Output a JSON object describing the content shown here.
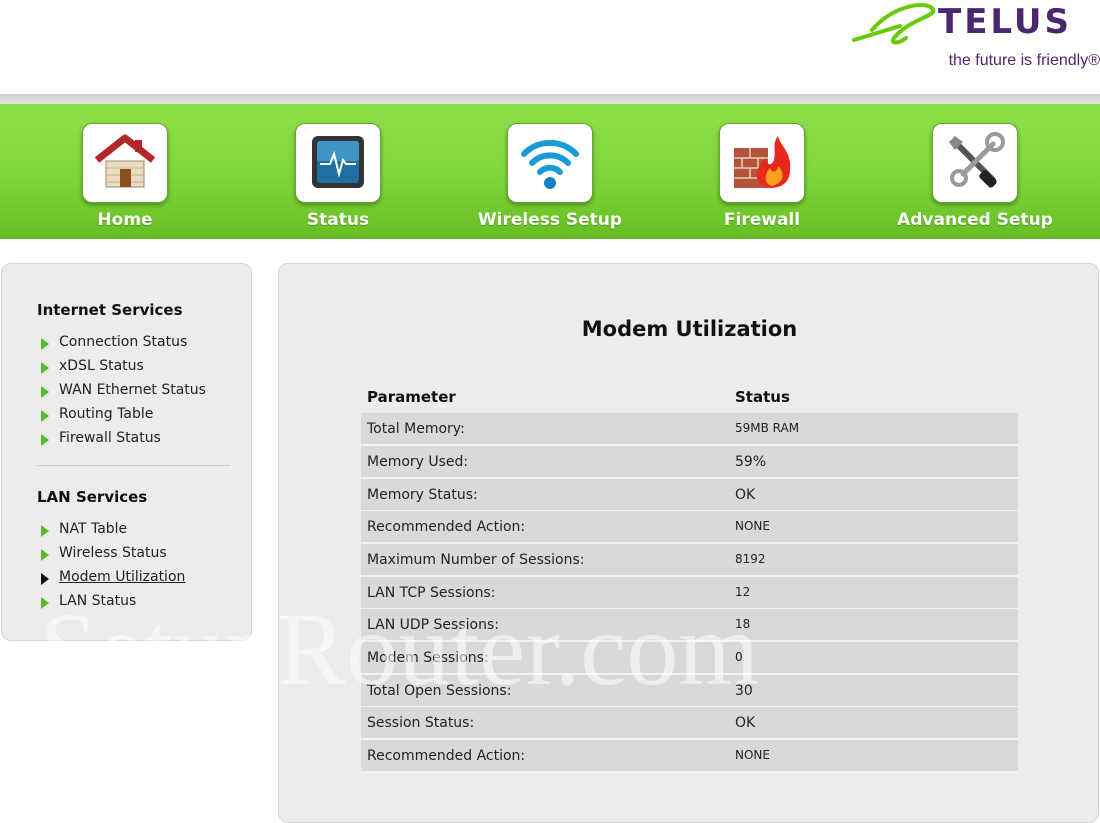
{
  "header": {
    "brand": "TELUS",
    "tagline": "the future is friendly®"
  },
  "nav": [
    {
      "label": "Home",
      "icon": "home-icon"
    },
    {
      "label": "Status",
      "icon": "monitor-icon"
    },
    {
      "label": "Wireless Setup",
      "icon": "wifi-icon"
    },
    {
      "label": "Firewall",
      "icon": "firewall-icon"
    },
    {
      "label": "Advanced Setup",
      "icon": "tools-icon"
    }
  ],
  "sidebar": {
    "internet_heading": "Internet Services",
    "internet_items": [
      "Connection Status",
      "xDSL Status",
      "WAN Ethernet Status",
      "Routing Table",
      "Firewall Status"
    ],
    "lan_heading": "LAN Services",
    "lan_items": [
      "NAT Table",
      "Wireless Status",
      "Modem Utilization",
      "LAN Status"
    ],
    "active_item": "Modem Utilization"
  },
  "main": {
    "title": "Modem Utilization",
    "col_parameter": "Parameter",
    "col_status": "Status",
    "rows": [
      {
        "param": "Total Memory:",
        "value": "59MB RAM"
      },
      {
        "param": "Memory Used:",
        "value": "59%"
      },
      {
        "param": "Memory Status:",
        "value": "OK"
      },
      {
        "param": "Recommended Action:",
        "value": "NONE"
      },
      {
        "param": "Maximum Number of Sessions:",
        "value": "8192"
      },
      {
        "param": "LAN TCP Sessions:",
        "value": "12"
      },
      {
        "param": "LAN UDP Sessions:",
        "value": "18"
      },
      {
        "param": "Modem Sessions:",
        "value": "0"
      },
      {
        "param": "Total Open Sessions:",
        "value": "30"
      },
      {
        "param": "Session Status:",
        "value": "OK"
      },
      {
        "param": "Recommended Action:",
        "value": "NONE"
      }
    ]
  },
  "watermark": "SetupRouter.com",
  "colors": {
    "nav_green": "#7ed639",
    "brand_purple": "#4b286d",
    "arrow_green": "#5cb82b",
    "panel_grey": "#ececec",
    "row_grey": "#d9d9d9"
  }
}
